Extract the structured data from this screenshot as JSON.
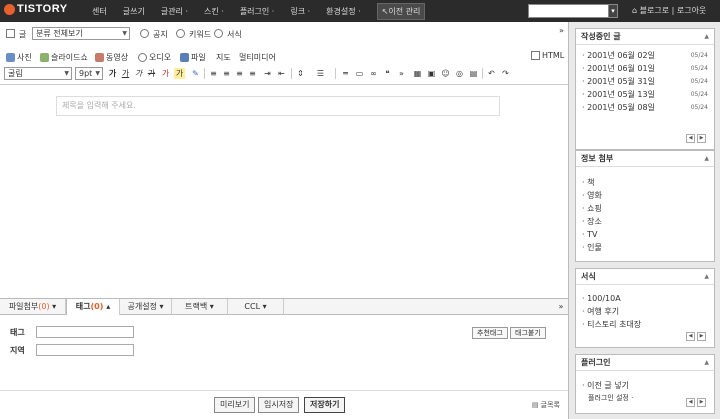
{
  "topbar": {
    "logo": "TISTORY",
    "nav": [
      "센터",
      "글쓰기",
      "글관리 ·",
      "스킨 ·",
      "플러그인 ·",
      "링크 ·",
      "환경설정 ·"
    ],
    "prev_manage": "↖이전 관리",
    "search_value": "",
    "blog_link": "⌂ 블로그로",
    "logout": "로그아웃"
  },
  "editor": {
    "category_select": "분류 전체보기",
    "category_label": "글",
    "radios": [
      "공지",
      "키워드",
      "서식"
    ],
    "html_label": "HTML",
    "media": [
      "사진",
      "슬라이드쇼",
      "동영상",
      "오디오",
      "파일",
      "지도",
      "멀티미디어"
    ],
    "font_select": "굴림",
    "size_select": "9pt",
    "title_placeholder": "제목을 입력해 주세요."
  },
  "tabs": {
    "attach": "파일첨부",
    "tag": "태그",
    "tag_count": "(0)",
    "attach_count": "(0)",
    "public": "공개설정",
    "trackback": "트랙백",
    "ccl": "CCL"
  },
  "tagpane": {
    "tag_label": "태그",
    "region_label": "지역",
    "recommend_btn": "추천태그",
    "tag_cloud_btn": "태그붙기"
  },
  "bottom": {
    "preview": "미리보기",
    "temp_save": "임시저장",
    "save": "저장하기",
    "list": "글목록"
  },
  "sidebar": {
    "drafts": {
      "title": "작성중인 글",
      "items": [
        {
          "label": "· 2001년 06월 02일",
          "date": "05/24"
        },
        {
          "label": "· 2001년 06월 01일",
          "date": "05/24"
        },
        {
          "label": "· 2001년 05월 31일",
          "date": "05/24"
        },
        {
          "label": "· 2001년 05월 13일",
          "date": "05/24"
        },
        {
          "label": "· 2001년 05월 08일",
          "date": "05/24"
        }
      ]
    },
    "info": {
      "title": "정보 첨부",
      "items": [
        "· 책",
        "· 영화",
        "· 쇼핑",
        "· 장소",
        "· TV",
        "· 인물"
      ]
    },
    "templates": {
      "title": "서식",
      "items": [
        "· 100/10A",
        "· 여행 후기",
        "· 티스토리 초대장"
      ]
    },
    "plugins": {
      "title": "플러그인",
      "items": [
        "· 이전 글 넣기"
      ],
      "settings": "플러그인 설정 ·"
    }
  }
}
